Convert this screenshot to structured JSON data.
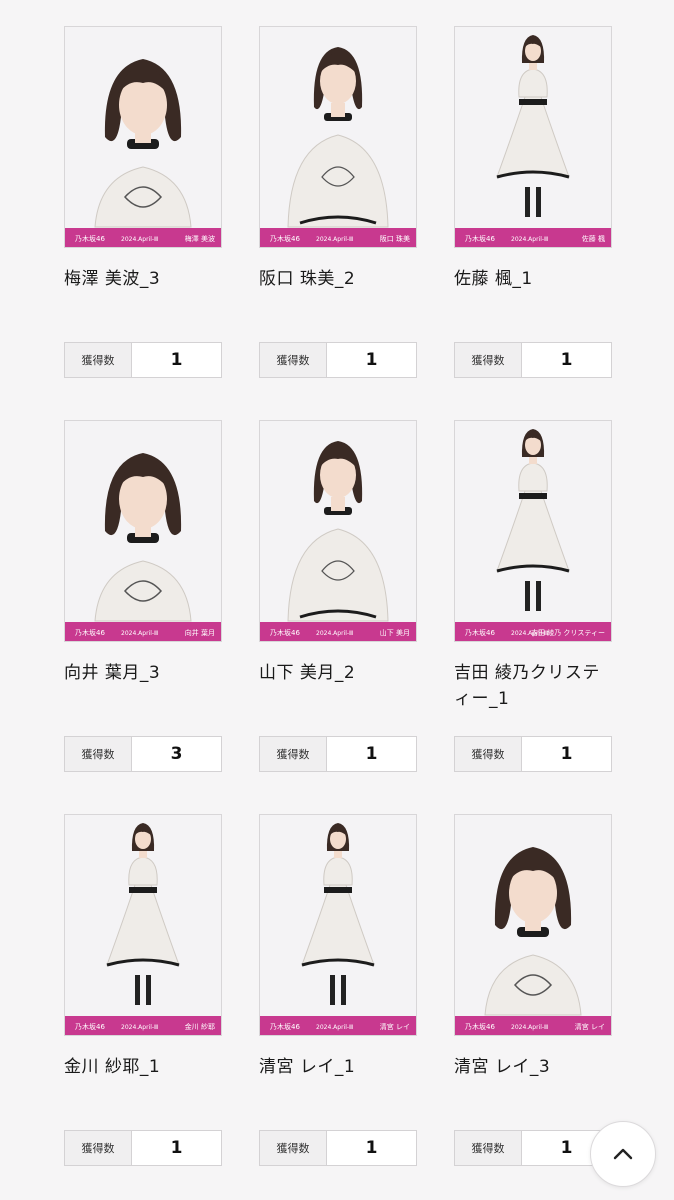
{
  "count_label": "獲得数",
  "brand_text": "乃木坂46",
  "date_text": "2024.April-Ⅲ",
  "accent_color": "#c8398f",
  "cards": [
    {
      "name": "梅澤 美波_3",
      "photo_caption": "梅澤 美波",
      "count": "1",
      "pose": "portrait"
    },
    {
      "name": "阪口 珠美_2",
      "photo_caption": "阪口 珠美",
      "count": "1",
      "pose": "half"
    },
    {
      "name": "佐藤 楓_1",
      "photo_caption": "佐藤 楓",
      "count": "1",
      "pose": "full"
    },
    {
      "name": "向井 葉月_3",
      "photo_caption": "向井 葉月",
      "count": "3",
      "pose": "portrait"
    },
    {
      "name": "山下 美月_2",
      "photo_caption": "山下 美月",
      "count": "1",
      "pose": "half"
    },
    {
      "name": "吉田 綾乃クリスティー_1",
      "photo_caption": "吉田 綾乃 クリスティー",
      "count": "1",
      "pose": "full"
    },
    {
      "name": "金川 紗耶_1",
      "photo_caption": "金川 紗耶",
      "count": "1",
      "pose": "full"
    },
    {
      "name": "清宮 レイ_1",
      "photo_caption": "清宮 レイ",
      "count": "1",
      "pose": "full"
    },
    {
      "name": "清宮 レイ_3",
      "photo_caption": "清宮 レイ",
      "count": "1",
      "pose": "portrait"
    }
  ],
  "scroll_top": {
    "icon": "chevron-up-icon"
  }
}
